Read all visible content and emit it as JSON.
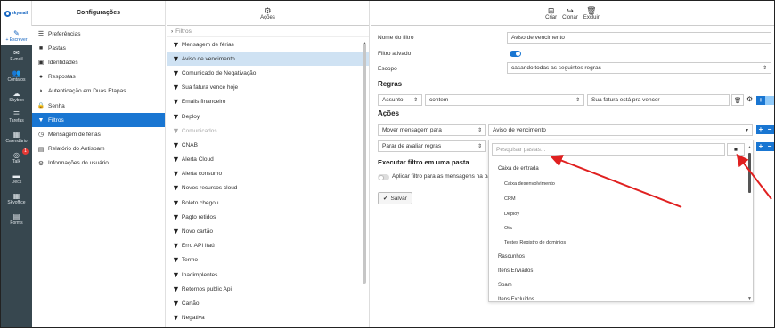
{
  "logo": {
    "text": "skymail"
  },
  "rail": [
    {
      "label": "+ Escrever",
      "icon": "compose-icon",
      "glyph": "✎",
      "active": true
    },
    {
      "label": "E-mail",
      "icon": "mail-icon",
      "glyph": "✉"
    },
    {
      "label": "Contatos",
      "icon": "contacts-icon",
      "glyph": "👥"
    },
    {
      "label": "Skybox",
      "icon": "skybox-icon",
      "glyph": "☁"
    },
    {
      "label": "Tarefas",
      "icon": "tasks-icon",
      "glyph": "☰"
    },
    {
      "label": "Calendário",
      "icon": "calendar-icon",
      "glyph": "▦"
    },
    {
      "label": "Talk",
      "icon": "talk-icon",
      "glyph": "◎",
      "badge": "1"
    },
    {
      "label": "Deck",
      "icon": "deck-icon",
      "glyph": "▬"
    },
    {
      "label": "Skyoffice",
      "icon": "skyoffice-icon",
      "glyph": "▦"
    },
    {
      "label": "Forms",
      "icon": "forms-icon",
      "glyph": "▤"
    }
  ],
  "settings": {
    "title": "Configurações",
    "items": [
      {
        "label": "Preferências",
        "icon": "preferences-icon",
        "glyph": "☰"
      },
      {
        "label": "Pastas",
        "icon": "folder-icon",
        "glyph": "■"
      },
      {
        "label": "Identidades",
        "icon": "identity-icon",
        "glyph": "▣"
      },
      {
        "label": "Respostas",
        "icon": "responses-icon",
        "glyph": "●"
      },
      {
        "label": "Autenticação em Duas Etapas",
        "icon": "shield-icon",
        "glyph": "◗"
      },
      {
        "label": "Senha",
        "icon": "lock-icon",
        "glyph": "🔒"
      },
      {
        "label": "Filtros",
        "icon": "filter-icon",
        "glyph": "▼",
        "active": true
      },
      {
        "label": "Mensagem de férias",
        "icon": "clock-icon",
        "glyph": "◷"
      },
      {
        "label": "Relatório do Antispam",
        "icon": "report-icon",
        "glyph": "▤"
      },
      {
        "label": "Informações do usuário",
        "icon": "gear-icon",
        "glyph": "⚙"
      }
    ]
  },
  "actions": {
    "title": "Ações",
    "filters_header": "Filtros",
    "filters": [
      {
        "label": "Mensagem de férias"
      },
      {
        "label": "Aviso de vencimento",
        "active": true
      },
      {
        "label": "Comunicado de Negativação"
      },
      {
        "label": "Sua fatura vence hoje"
      },
      {
        "label": "Emails financeiro"
      },
      {
        "label": "Deploy"
      },
      {
        "label": "Comunicados",
        "disabled": true
      },
      {
        "label": "CNAB"
      },
      {
        "label": "Alerta Cloud"
      },
      {
        "label": "Alerta consumo"
      },
      {
        "label": "Novos recursos cloud"
      },
      {
        "label": "Boleto chegou"
      },
      {
        "label": "Pagto retidos"
      },
      {
        "label": "Novo cartão"
      },
      {
        "label": "Erro API Itaú"
      },
      {
        "label": "Termo"
      },
      {
        "label": "Inadimplentes"
      },
      {
        "label": "Retornos public Api"
      },
      {
        "label": "Cartão"
      },
      {
        "label": "Negativa"
      }
    ]
  },
  "toolbar": {
    "create": "Criar",
    "clone": "Clonar",
    "delete": "Excluir"
  },
  "form": {
    "name_label": "Nome do filtro",
    "name_value": "Aviso de vencimento",
    "enabled_label": "Filtro ativado",
    "scope_label": "Escopo",
    "scope_value": "casando todas as seguintes regras",
    "rules_title": "Regras",
    "rule_field": "Assunto",
    "rule_op": "contem",
    "rule_value": "Sua fatura está pra vencer",
    "actions_title": "Ações",
    "action1": "Mover mensagem para",
    "action1_value": "Aviso de vencimento",
    "action2": "Parar de avaliar regras",
    "folder_placeholder": "Pesquisar pastas...",
    "run_title": "Executar filtro em uma pasta",
    "run_label": "Aplicar filtro para as mensagens na pa",
    "save": "Salvar"
  },
  "folders": [
    {
      "label": "Caixa de entrada"
    },
    {
      "label": "Caixa desenvolvimento",
      "sub": true
    },
    {
      "label": "CRM",
      "sub": true
    },
    {
      "label": "Deploy",
      "sub": true
    },
    {
      "label": "Ota",
      "sub": true
    },
    {
      "label": "Testes Registro de dominios",
      "sub": true
    },
    {
      "label": "Rascunhos"
    },
    {
      "label": "Itens Enviados"
    },
    {
      "label": "Spam"
    },
    {
      "label": "Itens Excluídos"
    }
  ],
  "colors": {
    "accent": "#1976d2",
    "rail": "#37474f",
    "selected_row": "#cfe2f3",
    "arrow": "#e02020"
  }
}
